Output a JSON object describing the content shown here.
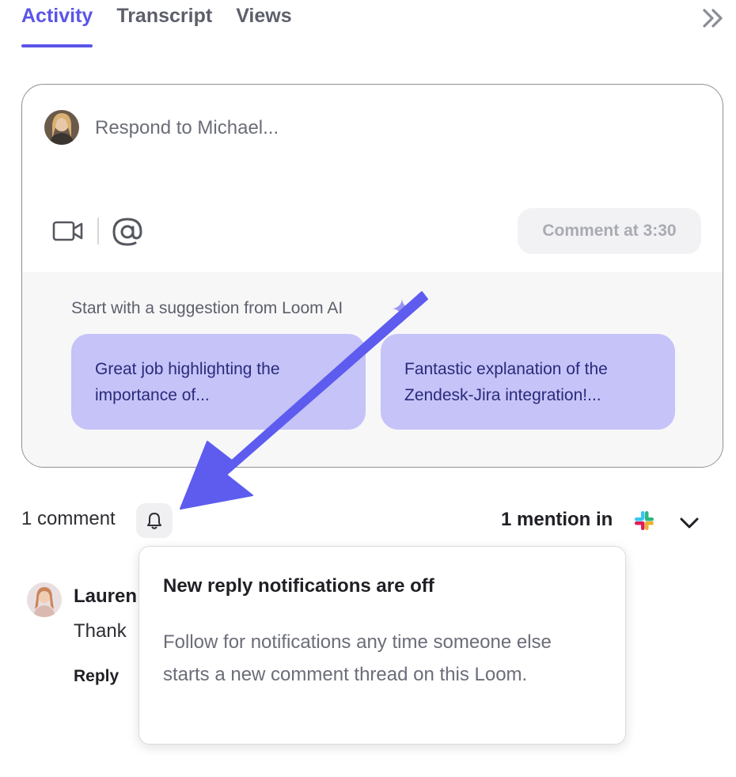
{
  "tabs": [
    {
      "label": "Activity",
      "active": true
    },
    {
      "label": "Transcript",
      "active": false
    },
    {
      "label": "Views",
      "active": false
    }
  ],
  "tab_actions": {
    "collapse_icon": "double-chevron-right-icon"
  },
  "composer": {
    "placeholder": "Respond to Michael...",
    "avatar": "user-avatar",
    "record_icon": "video-camera-icon",
    "mention_icon": "at-sign-icon",
    "comment_button": "Comment at 3:30"
  },
  "suggestions": {
    "title": "Start with a suggestion from Loom AI",
    "icon": "sparkle-icon",
    "items": [
      {
        "line1": "Great job highlighting the",
        "line2": "importance of..."
      },
      {
        "line1": "Fantastic explanation of the",
        "line2": "Zendesk-Jira integration!..."
      }
    ]
  },
  "comments_header": {
    "count_label": "1 comment",
    "bell_icon": "bell-icon",
    "mention_label": "1 mention in",
    "integration_icon": "slack-icon",
    "dropdown_icon": "chevron-down-icon"
  },
  "comment": {
    "author": "Lauren",
    "text": "Thank",
    "reply_label": "Reply"
  },
  "popover": {
    "title": "New reply notifications are off",
    "body": "Follow for notifications any time someone else starts a new comment thread on this Loom."
  },
  "colors": {
    "accent": "#5b55e8",
    "chip_bg": "#c5c3f8",
    "chip_text": "#2a2a7a",
    "arrow": "#5d5cef"
  }
}
